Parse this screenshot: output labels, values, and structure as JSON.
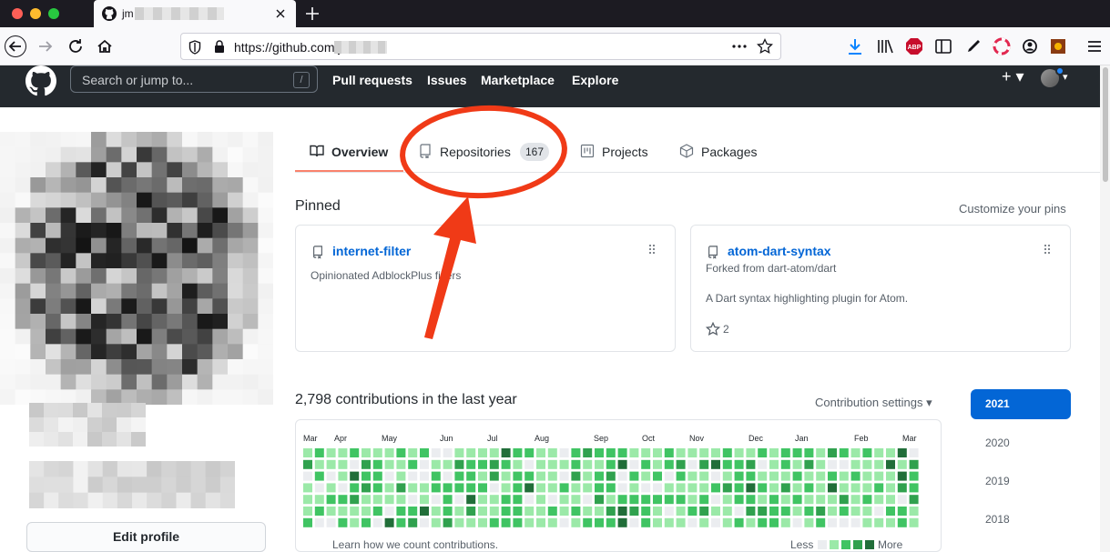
{
  "browser": {
    "tab_title": "jm",
    "url": "https://github.com/jm",
    "icons": [
      "back-icon",
      "forward-icon",
      "reload-icon",
      "home-icon",
      "shield-icon",
      "lock-icon",
      "more-dots-icon",
      "bookmark-star-icon",
      "download-icon",
      "library-icon",
      "adblock-icon",
      "reader-icon",
      "pen-icon",
      "lifebuoy-icon",
      "account-icon",
      "extension-icon",
      "menu-icon"
    ],
    "adblock_badge": "ABP"
  },
  "github_header": {
    "search_placeholder": "Search or jump to...",
    "search_shortcut": "/",
    "nav": [
      "Pull requests",
      "Issues",
      "Marketplace",
      "Explore"
    ],
    "plus": "+ ▾"
  },
  "profile": {
    "edit_profile": "Edit profile"
  },
  "tabs": [
    {
      "label": "Overview",
      "icon": "book-icon",
      "active": true
    },
    {
      "label": "Repositories",
      "icon": "repo-icon",
      "count": "167"
    },
    {
      "label": "Projects",
      "icon": "project-icon"
    },
    {
      "label": "Packages",
      "icon": "package-icon"
    }
  ],
  "pinned": {
    "title": "Pinned",
    "customize": "Customize your pins",
    "cards": [
      {
        "name": "internet-filter",
        "forked": "",
        "description": "Opinionated AdblockPlus filters",
        "stars": ""
      },
      {
        "name": "atom-dart-syntax",
        "forked": "Forked from dart-atom/dart",
        "description": "A Dart syntax highlighting plugin for Atom.",
        "stars": "2"
      }
    ]
  },
  "contributions": {
    "title": "2,798 contributions in the last year",
    "settings": "Contribution settings ▾",
    "months": [
      "Mar",
      "Apr",
      "May",
      "Jun",
      "Jul",
      "Aug",
      "Sep",
      "Oct",
      "Nov",
      "Dec",
      "Jan",
      "Feb",
      "Mar"
    ],
    "learn": "Learn how we count contributions.",
    "less": "Less",
    "more": "More",
    "colors": [
      "#ebedf0",
      "#9be9a8",
      "#40c463",
      "#30a14e",
      "#216e39"
    ]
  },
  "years": [
    "2021",
    "2020",
    "2019",
    "2018"
  ],
  "annotation": {
    "color": "#f03a17"
  }
}
